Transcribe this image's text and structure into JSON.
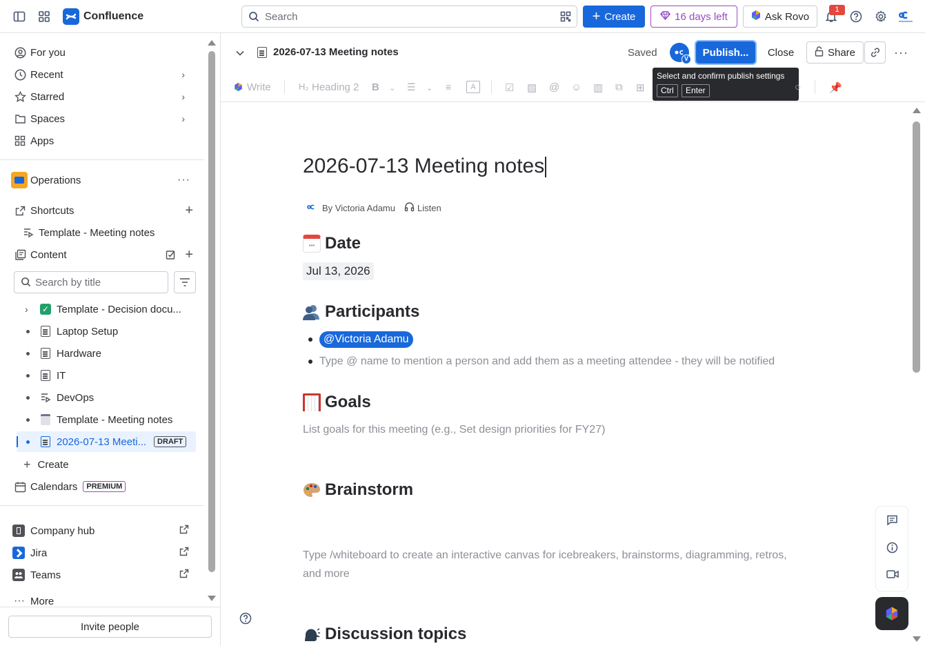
{
  "topbar": {
    "app_name": "Confluence",
    "search_placeholder": "Search",
    "create_label": "Create",
    "trial_label": "16 days left",
    "rovo_label": "Ask Rovo",
    "notification_count": "1"
  },
  "sidebar": {
    "nav": [
      "For you",
      "Recent",
      "Starred",
      "Spaces",
      "Apps"
    ],
    "space_name": "Operations",
    "shortcuts_label": "Shortcuts",
    "shortcut_item": "Template - Meeting notes",
    "content_label": "Content",
    "search_placeholder": "Search by title",
    "tree": [
      {
        "label": "Template - Decision docu..."
      },
      {
        "label": "Laptop Setup"
      },
      {
        "label": "Hardware"
      },
      {
        "label": "IT"
      },
      {
        "label": "DevOps"
      },
      {
        "label": "Template - Meeting notes"
      },
      {
        "label": "2026-07-13 Meeti...",
        "badge": "DRAFT"
      }
    ],
    "create_label": "Create",
    "calendars_label": "Calendars",
    "premium_badge": "PREMIUM",
    "apps": [
      "Company hub",
      "Jira",
      "Teams"
    ],
    "more_label": "More",
    "invite_label": "Invite people"
  },
  "editor_header": {
    "title": "2026-07-13 Meeting notes",
    "saved_label": "Saved",
    "avatar_badge": "V",
    "publish_label": "Publish...",
    "close_label": "Close",
    "share_label": "Share"
  },
  "tooltip": {
    "text": "Select and confirm publish settings",
    "key1": "Ctrl",
    "key2": "Enter"
  },
  "toolbar": {
    "write_label": "Write",
    "heading_label": "Heading 2",
    "bold_label": "B"
  },
  "document": {
    "title": "2026-07-13 Meeting notes",
    "byline": "By Victoria Adamu",
    "listen_label": "Listen",
    "date_heading": "Date",
    "date_value": "Jul 13, 2026",
    "participants_heading": "Participants",
    "mention": "@Victoria Adamu",
    "participants_placeholder": "Type @ name to mention a person and add them as a meeting attendee - they will be notified",
    "goals_heading": "Goals",
    "goals_placeholder": "List goals for this meeting (e.g., Set design priorities for FY27)",
    "brainstorm_heading": "Brainstorm",
    "brainstorm_placeholder_1": "Type /whiteboard to create an interactive canvas for icebreakers, brainstorms, diagramming, retros,",
    "brainstorm_placeholder_2": "and more",
    "discussion_heading": "Discussion topics"
  },
  "colors": {
    "brand_blue": "#1868db",
    "trial_purple": "#964ac0",
    "mention_bg": "#1868db",
    "selected_bg": "#e9f2fe"
  }
}
